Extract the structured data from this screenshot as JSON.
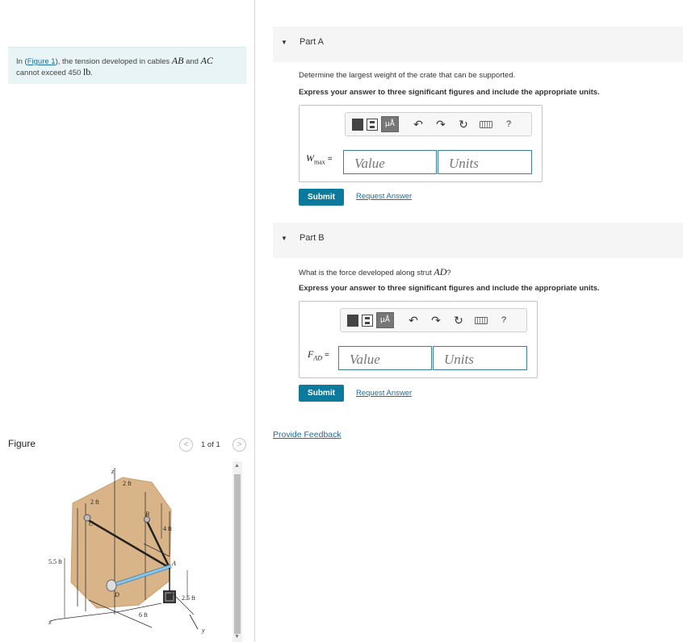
{
  "problem": {
    "prefix": "In (",
    "figure_link": "Figure 1",
    "middle1": "), the tension developed in cables ",
    "cable1": "AB",
    "and": " and ",
    "cable2": "AC",
    "line2": "cannot exceed 450 ",
    "unit": "lb",
    "end": "."
  },
  "figure_panel": {
    "title": "Figure",
    "prev_icon": "chevron-left-icon",
    "next_icon": "chevron-right-icon",
    "page_text": "1 of 1",
    "labels": {
      "z": "z",
      "x": "x",
      "y": "y",
      "dim_2ft_top": "2 ft",
      "dim_2ft_left": "2 ft",
      "dim_4ft": "4 ft",
      "dim_55ft": "5.5 ft",
      "dim_25ft": "2.5 ft",
      "dim_6ft": "6 ft",
      "point_a": "A",
      "point_b": "B",
      "point_c": "C",
      "point_d": "D"
    }
  },
  "parts": [
    {
      "label": "Part A",
      "question_text": "Determine the largest weight of the crate that can be supported.",
      "question_var": "",
      "question_end": "",
      "instruction": "Express your answer to three significant figures and include the appropriate units.",
      "var_name": "W",
      "var_sub": "max",
      "equals": "=",
      "value_placeholder": "Value",
      "units_placeholder": "Units",
      "submit_label": "Submit",
      "request_label": "Request Answer"
    },
    {
      "label": "Part B",
      "question_text": "What is the force developed along strut ",
      "question_var": "AD",
      "question_end": "?",
      "instruction": "Express your answer to three significant figures and include the appropriate units.",
      "var_name": "F",
      "var_sub": "AD",
      "equals": "=",
      "value_placeholder": "Value",
      "units_placeholder": "Units",
      "submit_label": "Submit",
      "request_label": "Request Answer"
    }
  ],
  "toolbar": {
    "mu_label": "μÅ",
    "undo_glyph": "↶",
    "redo_glyph": "↷",
    "reset_glyph": "↻",
    "help_glyph": "?"
  },
  "feedback_label": "Provide Feedback",
  "colors": {
    "accent": "#0b7a9c",
    "link": "#1a6e9e",
    "problem_bg": "#e8f4f6",
    "wall": "#d9b488",
    "strut": "#8cc4e8"
  }
}
